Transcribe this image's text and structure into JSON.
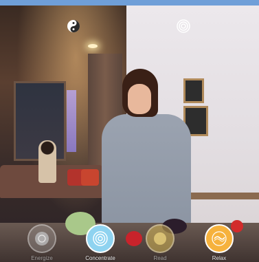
{
  "header": {
    "accent": "#6f9fd8"
  },
  "scene_icons": [
    {
      "name": "yin-yang-icon"
    },
    {
      "name": "concentric-circles-icon"
    }
  ],
  "modes": [
    {
      "label": "Energize",
      "color": "#cfd6dc",
      "icon": "energize-icon",
      "state": "dim"
    },
    {
      "label": "Concentrate",
      "color": "#8fd3f0",
      "icon": "concentrate-icon",
      "state": "active"
    },
    {
      "label": "Read",
      "color": "#f4d35e",
      "icon": "read-icon",
      "state": "dim"
    },
    {
      "label": "Relax",
      "color": "#f6b23d",
      "icon": "relax-icon",
      "state": "active"
    }
  ]
}
